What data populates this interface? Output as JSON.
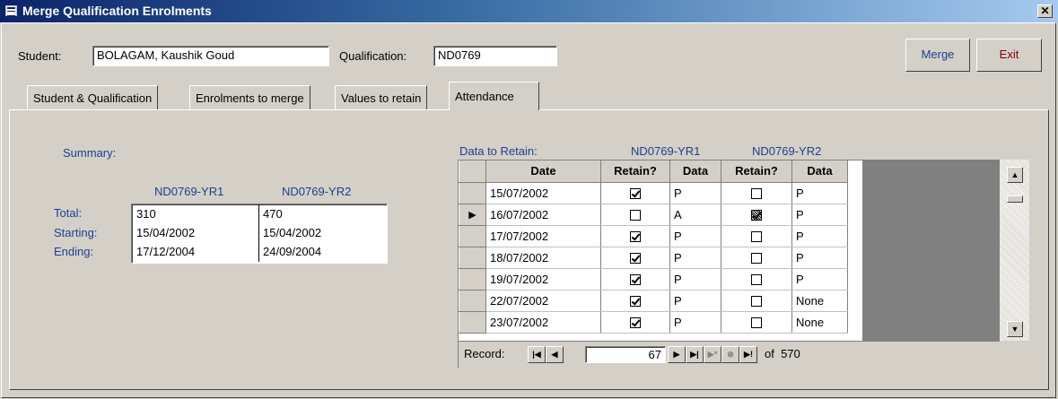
{
  "window": {
    "title": "Merge Qualification Enrolments",
    "close_glyph": "✕"
  },
  "header": {
    "student_label": "Student:",
    "student_value": "BOLAGAM, Kaushik Goud",
    "qualification_label": "Qualification:",
    "qualification_value": "ND0769",
    "merge_label": "Merge",
    "exit_label": "Exit"
  },
  "tabs": [
    {
      "label": "Student & Qualification"
    },
    {
      "label": "Enrolments to merge"
    },
    {
      "label": "Values to retain"
    },
    {
      "label": "Attendance"
    }
  ],
  "summary": {
    "heading": "Summary:",
    "col1": "ND0769-YR1",
    "col2": "ND0769-YR2",
    "rows": [
      {
        "label": "Total:",
        "v1": "310",
        "v2": "470"
      },
      {
        "label": "Starting:",
        "v1": "15/04/2002",
        "v2": "15/04/2002"
      },
      {
        "label": "Ending:",
        "v1": "17/12/2004",
        "v2": "24/09/2004"
      }
    ]
  },
  "retain": {
    "heading": "Data to Retain:",
    "group1": "ND0769-YR1",
    "group2": "ND0769-YR2",
    "columns": [
      "Date",
      "Retain?",
      "Data",
      "Retain?",
      "Data"
    ],
    "rows": [
      {
        "date": "15/07/2002",
        "r1": true,
        "d1": "P",
        "r2": false,
        "d2": "P"
      },
      {
        "date": "16/07/2002",
        "r1": false,
        "d1": "A",
        "r2": true,
        "d2": "P"
      },
      {
        "date": "17/07/2002",
        "r1": true,
        "d1": "P",
        "r2": false,
        "d2": "P"
      },
      {
        "date": "18/07/2002",
        "r1": true,
        "d1": "P",
        "r2": false,
        "d2": "P"
      },
      {
        "date": "19/07/2002",
        "r1": true,
        "d1": "P",
        "r2": false,
        "d2": "P"
      },
      {
        "date": "22/07/2002",
        "r1": true,
        "d1": "P",
        "r2": false,
        "d2": "None"
      },
      {
        "date": "23/07/2002",
        "r1": true,
        "d1": "P",
        "r2": false,
        "d2": "None"
      }
    ],
    "current_row_index": 1
  },
  "navigation": {
    "record_label": "Record:",
    "current": "67",
    "of_text": "of  570",
    "icons": [
      "first-record-icon",
      "previous-record-icon",
      "next-record-icon",
      "last-record-icon",
      "new-record-icon",
      "delete-record-icon",
      "sort-icon"
    ]
  }
}
